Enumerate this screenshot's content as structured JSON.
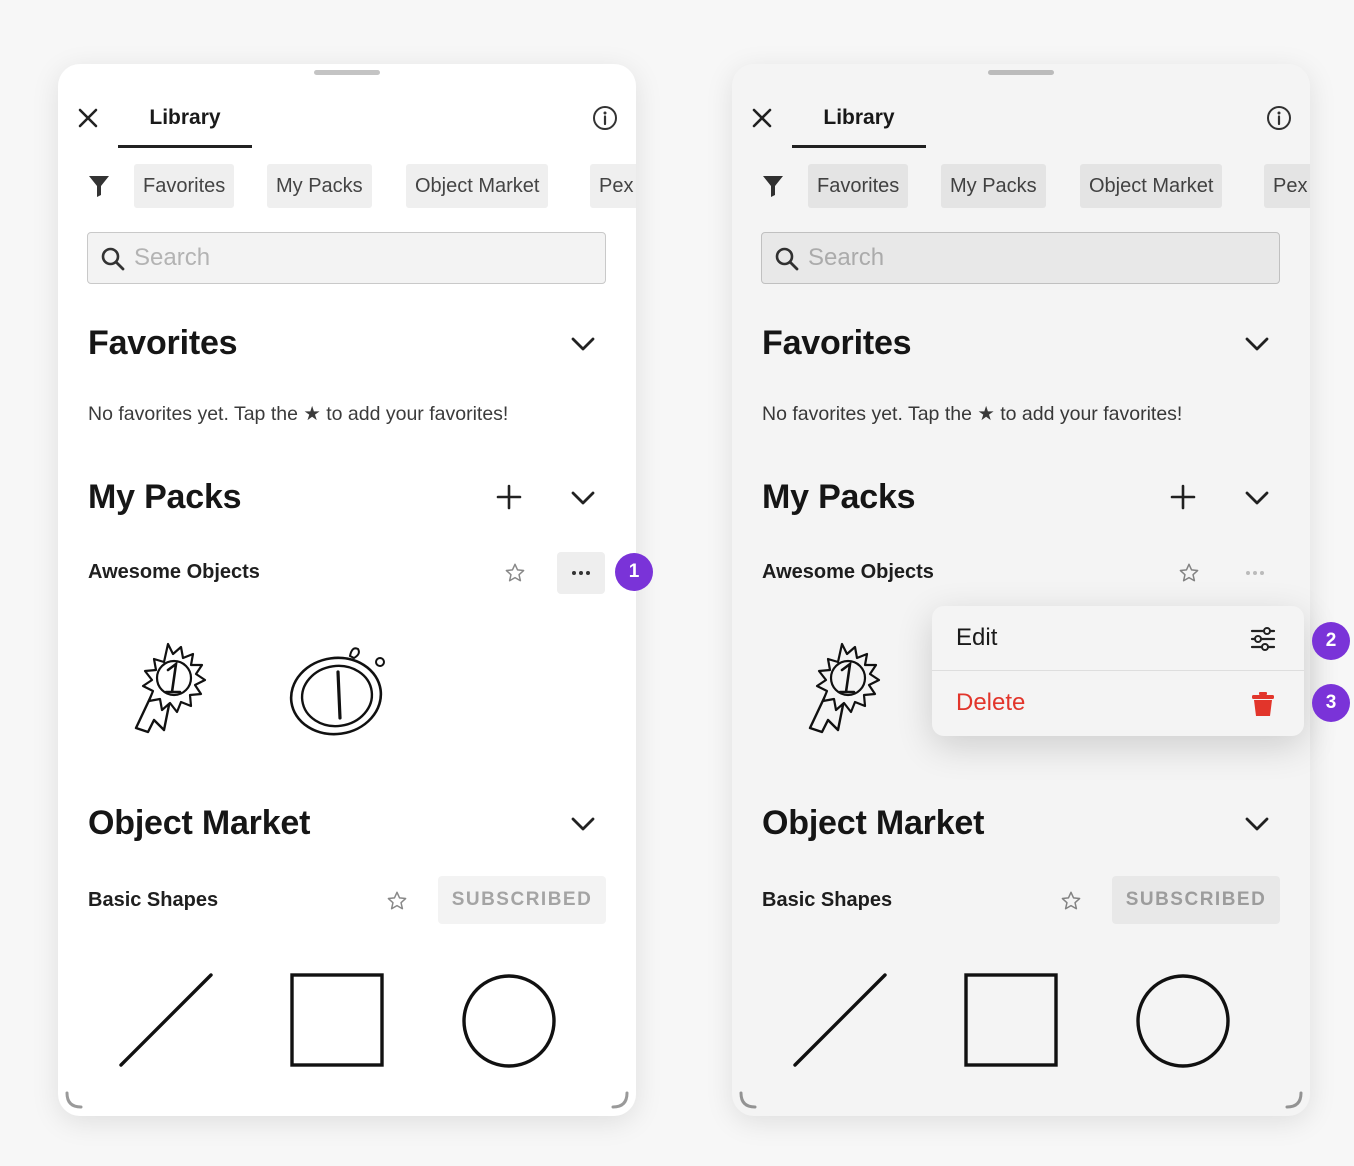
{
  "panels": {
    "left": {
      "tab_title": "Library",
      "filter_chips": [
        "Favorites",
        "My Packs",
        "Object Market",
        "Pex"
      ],
      "search_placeholder": "Search",
      "favorites": {
        "title": "Favorites",
        "empty_note": "No favorites yet. Tap the ★ to add your favorites!"
      },
      "my_packs": {
        "title": "My Packs",
        "pack_name": "Awesome Objects",
        "more_label": "···"
      },
      "object_market": {
        "title": "Object Market",
        "pack_name": "Basic Shapes",
        "subscribed_label": "SUBSCRIBED"
      }
    },
    "right": {
      "tab_title": "Library",
      "filter_chips": [
        "Favorites",
        "My Packs",
        "Object Market",
        "Pex"
      ],
      "search_placeholder": "Search",
      "favorites": {
        "title": "Favorites",
        "empty_note": "No favorites yet. Tap the ★ to add your favorites!"
      },
      "my_packs": {
        "title": "My Packs",
        "pack_name": "Awesome Objects"
      },
      "object_market": {
        "title": "Object Market",
        "pack_name": "Basic Shapes",
        "subscribed_label": "SUBSCRIBED"
      }
    }
  },
  "context_menu": {
    "edit_label": "Edit",
    "delete_label": "Delete"
  },
  "step_badges": [
    "1",
    "2",
    "3"
  ],
  "colors": {
    "accent_badge": "#7a33d8",
    "delete_red": "#e2352b",
    "text_primary": "#1a1a1a",
    "chip_bg": "#efefef"
  },
  "icons": [
    "close-icon",
    "info-icon",
    "filter-icon",
    "search-icon",
    "chevron-down-icon",
    "plus-icon",
    "star-outline-icon",
    "more-icon",
    "sliders-icon",
    "trash-icon"
  ]
}
